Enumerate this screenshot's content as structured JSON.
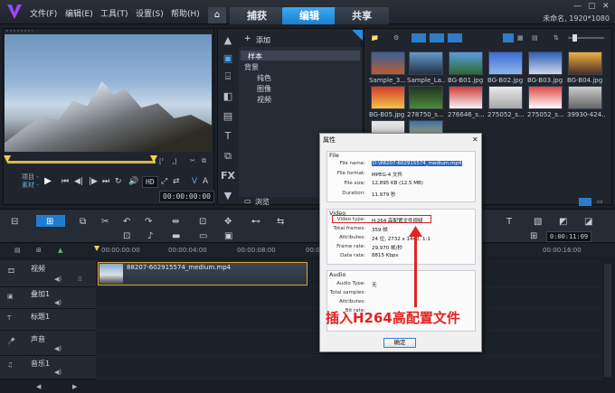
{
  "menu": [
    "文件(F)",
    "编辑(E)",
    "工具(T)",
    "设置(S)",
    "帮助(H)"
  ],
  "tabs": {
    "capture": "捕获",
    "edit": "编辑",
    "share": "共享"
  },
  "project_info": "未命名, 1920*1080",
  "preview": {
    "mode_project": "项目 -",
    "mode_clip": "素材 -",
    "timecode": "00:00:00:00",
    "quality": "HD"
  },
  "library": {
    "add_label": "添加",
    "browse_label": "浏览",
    "tree": [
      "样本",
      "背景",
      "纯色",
      "图像",
      "视频"
    ]
  },
  "media": [
    {
      "label": "Sample_3..."
    },
    {
      "label": "Sample_La..."
    },
    {
      "label": "BG-B01.jpg"
    },
    {
      "label": "BG-B02.jpg"
    },
    {
      "label": "BG-B03.jpg"
    },
    {
      "label": "BG-B04.jpg"
    },
    {
      "label": "BG-B05.jpg"
    },
    {
      "label": "278750_s..."
    },
    {
      "label": "276646_s..."
    },
    {
      "label": "275052_s..."
    },
    {
      "label": "275052_s..."
    },
    {
      "label": "39930-424..."
    }
  ],
  "timeline": {
    "ruler": [
      "00:00:00:00",
      "00:00:04:00",
      "00:00:08:00",
      "00:00:12:00",
      "00:00:16:00"
    ],
    "timecode": "0:00:11:09",
    "tracks": [
      "视频",
      "叠加1",
      "标题1",
      "声音",
      "音乐1"
    ],
    "clip_label": "88207-602915574_medium.mp4"
  },
  "dialog": {
    "title": "属性",
    "file_group": "File",
    "video_group": "Video",
    "audio_group": "Audio",
    "file_props": [
      {
        "label": "File name:",
        "value": "D:\\88207-602915574_medium.mp4"
      },
      {
        "label": "File format:",
        "value": "MPEG-4 文件"
      },
      {
        "label": "File size:",
        "value": "12,895 KB (12.5 MB)"
      },
      {
        "label": "Duration:",
        "value": "11.979 秒"
      }
    ],
    "video_props": [
      {
        "label": "Video type:",
        "value": "H.264 高配置文件视频"
      },
      {
        "label": "Total frames:",
        "value": "359 帧"
      },
      {
        "label": "Attributes:",
        "value": "24 位, 2732 x 1440, 1:1"
      },
      {
        "label": "Frame rate:",
        "value": "29.970 帧/秒"
      },
      {
        "label": "Data rate:",
        "value": "8815 Kbps"
      }
    ],
    "audio_props": [
      {
        "label": "Audio Type:",
        "value": "无"
      },
      {
        "label": "Total samples:",
        "value": ""
      },
      {
        "label": "Attributes:",
        "value": ""
      },
      {
        "label": "Bit rate:",
        "value": ""
      }
    ],
    "ok_label": "确定"
  },
  "annotation": "插入H264高配置文件",
  "colors": {
    "accent": "#1a7fcf",
    "highlight": "#e02020",
    "clip_border": "#e2a23a"
  }
}
